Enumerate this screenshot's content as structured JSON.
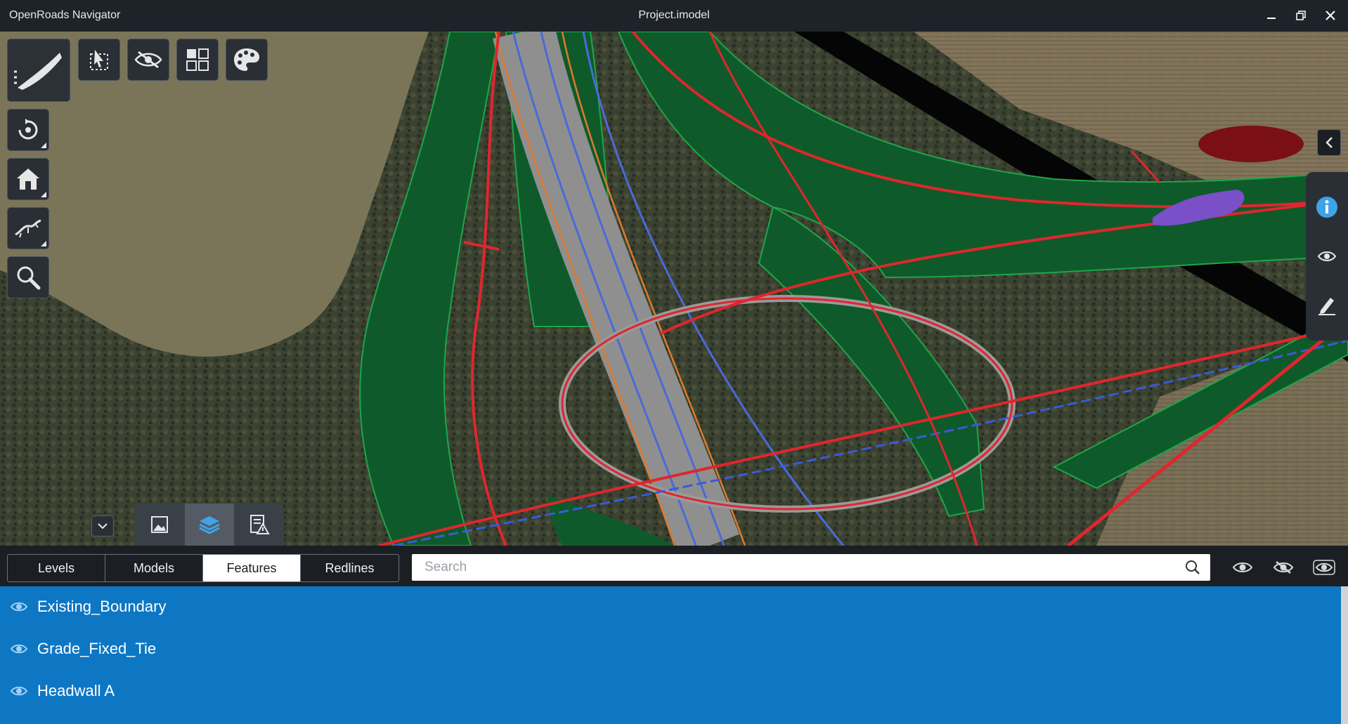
{
  "window": {
    "app_title": "OpenRoads Navigator",
    "document_title": "Project.imodel",
    "controls": [
      "minimize-icon",
      "restore-icon",
      "close-icon"
    ]
  },
  "toolbar_top": [
    "road-view-icon",
    "select-icon",
    "hide-icon",
    "view-layout-icon",
    "palette-icon"
  ],
  "toolbar_side": [
    "orbit-icon",
    "home-icon",
    "walk-icon",
    "zoom-icon"
  ],
  "bottom_tabs": [
    "views-icon",
    "layers-icon",
    "issues-icon"
  ],
  "right_panel": [
    "info-icon",
    "visibility-icon",
    "markup-icon"
  ],
  "filter": {
    "tabs": [
      {
        "label": "Levels"
      },
      {
        "label": "Models"
      },
      {
        "label": "Features"
      },
      {
        "label": "Redlines"
      }
    ],
    "active_tab": "Features",
    "search_placeholder": "Search",
    "visibility_buttons": [
      "show-all-icon",
      "hide-all-icon",
      "isolate-icon"
    ]
  },
  "features": [
    {
      "label": "Existing_Boundary"
    },
    {
      "label": "Grade_Fixed_Tie"
    },
    {
      "label": "Headwall A"
    }
  ],
  "colors": {
    "accent_blue": "#0d77c4",
    "titlebar": "#1e2329",
    "corridor_green": "#0f5a2a",
    "alignment_red": "#e0262e"
  }
}
